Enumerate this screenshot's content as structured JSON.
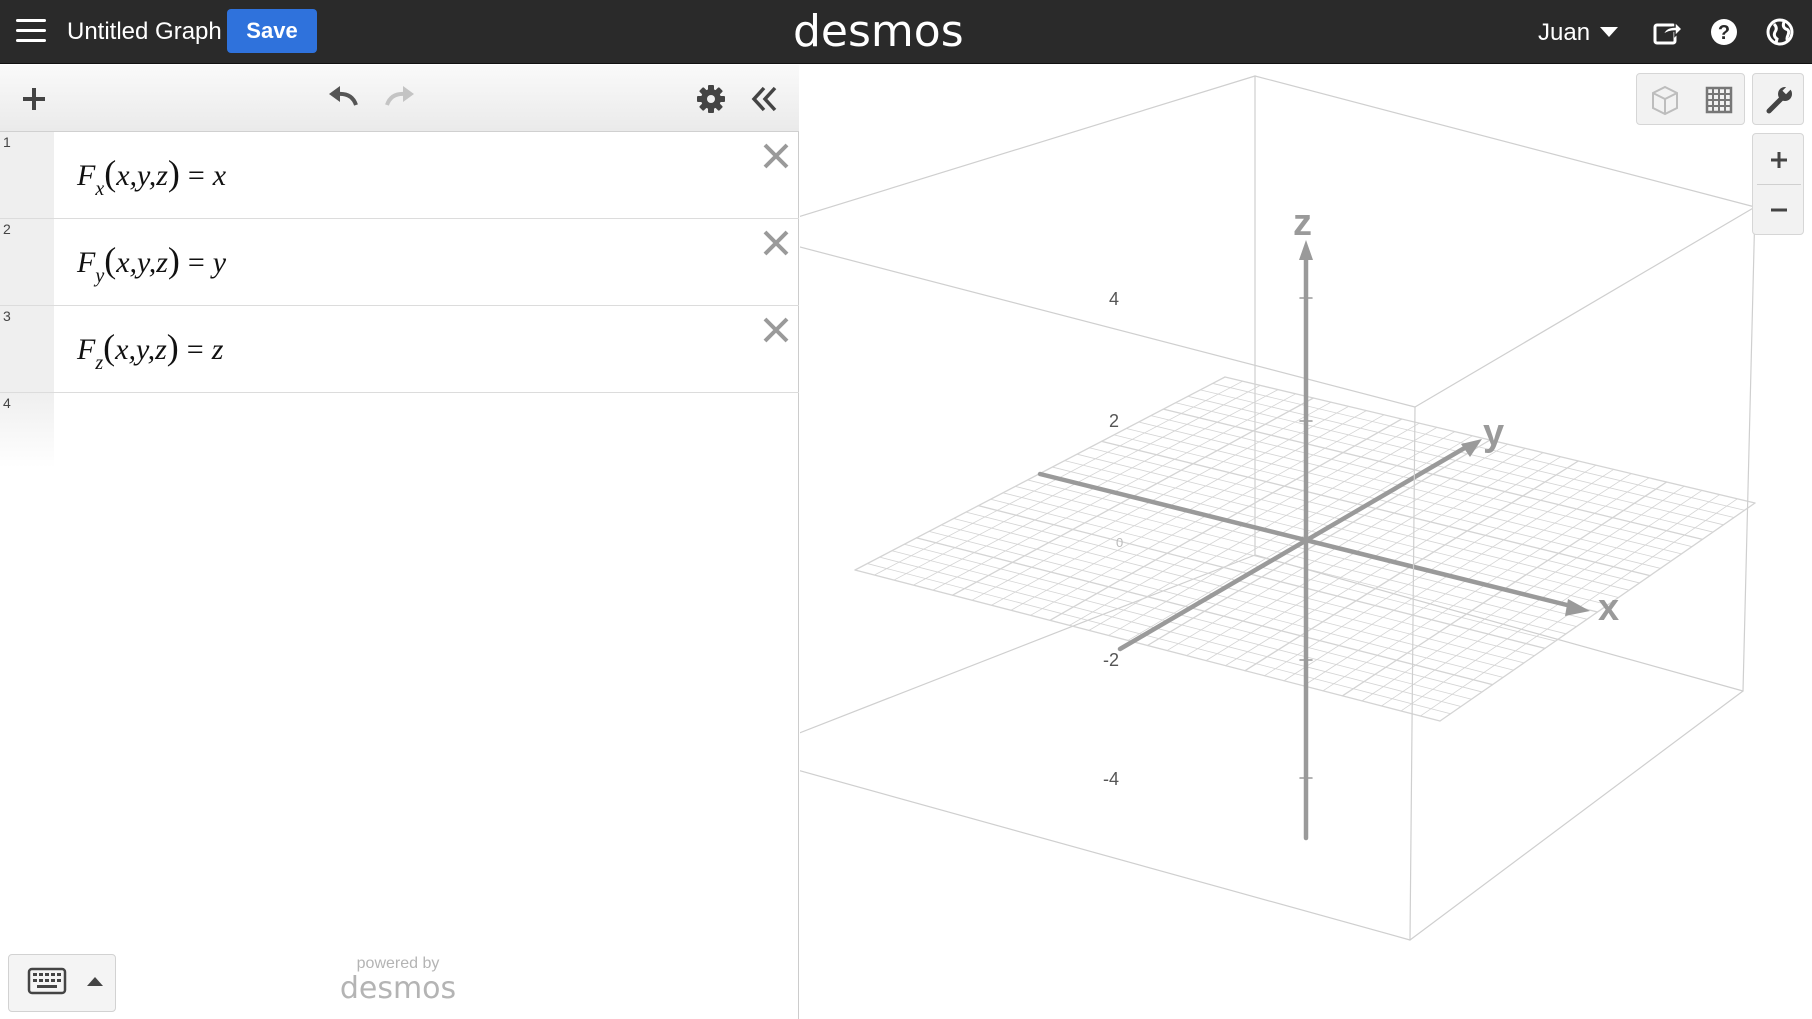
{
  "header": {
    "graph_title": "Untitled Graph",
    "save_label": "Save",
    "brand": "desmos",
    "user_name": "Juan"
  },
  "expressions": [
    {
      "index": "1",
      "func": "F",
      "sub": "x",
      "args": "x,y,z",
      "rhs": "x"
    },
    {
      "index": "2",
      "func": "F",
      "sub": "y",
      "args": "x,y,z",
      "rhs": "y"
    },
    {
      "index": "3",
      "func": "F",
      "sub": "z",
      "args": "x,y,z",
      "rhs": "z"
    },
    {
      "index": "4"
    }
  ],
  "footer": {
    "powered_by": "powered by",
    "brand": "desmos"
  },
  "graph": {
    "axis_labels": {
      "x": "x",
      "y": "y",
      "z": "z"
    },
    "z_ticks": [
      "4",
      "2",
      "-2",
      "-4"
    ],
    "origin_label": "0",
    "axis_color": "#9a9a9a",
    "grid_color": "#d4d4d4",
    "box_color": "#cfcfcf"
  },
  "colors": {
    "header_bg": "#2a2a2a",
    "save_button": "#2f72dc"
  }
}
